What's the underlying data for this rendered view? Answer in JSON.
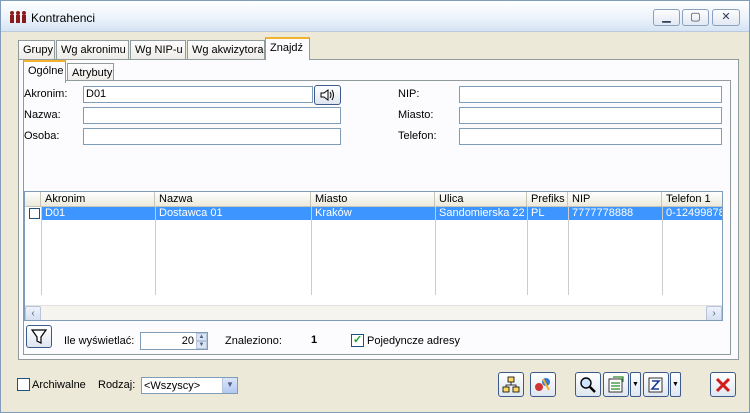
{
  "window": {
    "title": "Kontrahenci"
  },
  "icons": {
    "app": "people-icon",
    "minimize": "minimize-icon",
    "maximize": "maximize-icon",
    "close": "close-icon",
    "speaker": "speaker-icon",
    "filter": "filter-icon",
    "hierarchy": "hierarchy-icon",
    "relations": "relations-icon",
    "search": "magnifier-icon",
    "export": "export-icon",
    "sort": "sort-az-icon",
    "cancel": "red-x-icon"
  },
  "tabs_main": [
    "Grupy",
    "Wg akronimu",
    "Wg NIP-u",
    "Wg akwizytora",
    "Znajdź"
  ],
  "tabs_sub": [
    "Ogólne",
    "Atrybuty"
  ],
  "form": {
    "akronim_label": "Akronim:",
    "akronim_value": "D01",
    "nazwa_label": "Nazwa:",
    "osoba_label": "Osoba:",
    "nip_label": "NIP:",
    "miasto_label": "Miasto:",
    "telefon_label": "Telefon:"
  },
  "grid": {
    "columns": [
      "Akronim",
      "Nazwa",
      "Miasto",
      "Ulica",
      "Prefiks",
      "NIP",
      "Telefon 1"
    ],
    "rows": [
      [
        "D01",
        "Dostawca 01",
        "Kraków",
        "Sandomierska 22",
        "PL",
        "7777778888",
        "0-12499878"
      ]
    ]
  },
  "bottom": {
    "ile_label": "Ile wyświetlać:",
    "ile_value": "20",
    "znaleziono_label": "Znaleziono:",
    "znaleziono_value": "1",
    "pojedyncze_label": "Pojedyncze adresy",
    "pojedyncze_checked": true
  },
  "footer": {
    "archiwalne_label": "Archiwalne",
    "archiwalne_checked": false,
    "rodzaj_label": "Rodzaj:",
    "rodzaj_value": "<Wszyscy>"
  },
  "colors": {
    "selection": "#3d95ff",
    "active_tab_accent": "#f2b230"
  }
}
